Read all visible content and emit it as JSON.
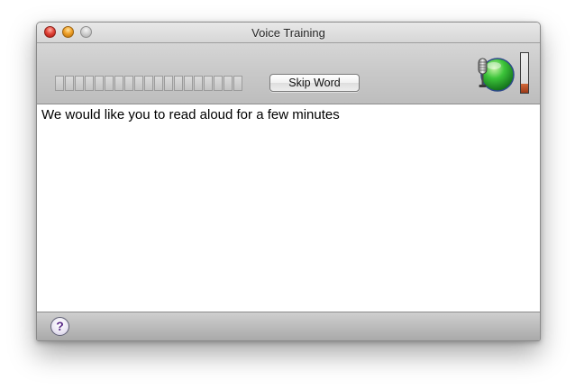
{
  "window": {
    "title": "Voice Training"
  },
  "toolbar": {
    "level_meter_segments": 19,
    "skip_label": "Skip Word",
    "input_level_fraction": 0.22
  },
  "content": {
    "instruction": "We would like you to read aloud for a few minutes"
  },
  "footer": {
    "help_label": "?"
  },
  "icons": {
    "microphone": "microphone-icon",
    "help": "help-icon"
  },
  "colors": {
    "feedback_green": "#3cc43a",
    "input_level": "#b0461f",
    "help_text": "#5a2a88"
  }
}
